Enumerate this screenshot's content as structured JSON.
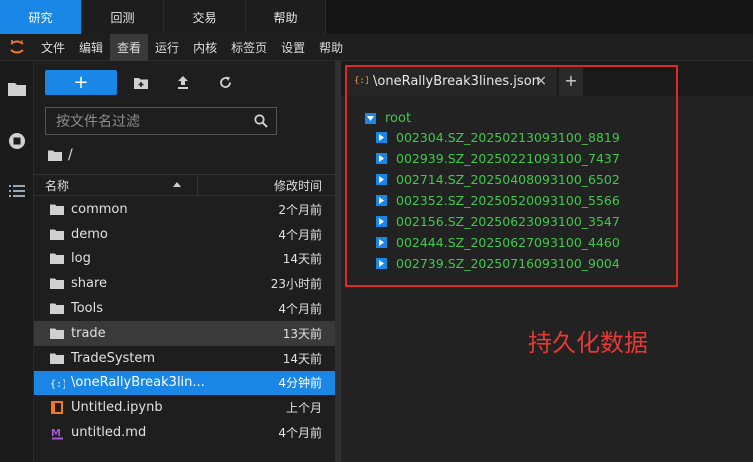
{
  "top_tabs": [
    "研究",
    "回测",
    "交易",
    "帮助"
  ],
  "menu": [
    "文件",
    "编辑",
    "查看",
    "运行",
    "内核",
    "标签页",
    "设置",
    "帮助"
  ],
  "file_browser": {
    "new_label": "+",
    "filter_placeholder": "按文件名过滤",
    "path": "/",
    "col_name": "名称",
    "col_modified": "修改时间",
    "files": [
      {
        "name": "common",
        "modified": "2个月前",
        "icon": "folder-icon"
      },
      {
        "name": "demo",
        "modified": "4个月前",
        "icon": "folder-icon"
      },
      {
        "name": "log",
        "modified": "14天前",
        "icon": "folder-icon"
      },
      {
        "name": "share",
        "modified": "23小时前",
        "icon": "folder-icon"
      },
      {
        "name": "Tools",
        "modified": "4个月前",
        "icon": "folder-icon"
      },
      {
        "name": "trade",
        "modified": "13天前",
        "icon": "folder-icon"
      },
      {
        "name": "TradeSystem",
        "modified": "14天前",
        "icon": "folder-icon"
      },
      {
        "name": "\\oneRallyBreak3lin...",
        "modified": "4分钟前",
        "icon": "json-file-icon"
      },
      {
        "name": "Untitled.ipynb",
        "modified": "上个月",
        "icon": "notebook-icon"
      },
      {
        "name": "untitled.md",
        "modified": "4个月前",
        "icon": "markdown-icon"
      }
    ]
  },
  "editor": {
    "tab_title": "\\oneRallyBreak3lines.json",
    "close_glyph": "×",
    "add_glyph": "+",
    "root_label": "root",
    "items": [
      "002304.SZ_20250213093100_8819",
      "002939.SZ_20250221093100_7437",
      "002714.SZ_20250408093100_6502",
      "002352.SZ_20250520093100_5566",
      "002156.SZ_20250623093100_3547",
      "002444.SZ_20250627093100_4460",
      "002739.SZ_20250716093100_9004"
    ],
    "annotation": "持久化数据"
  },
  "colors": {
    "accent": "#1a87e6",
    "tree_text": "#3fc94a",
    "annotation": "#e53935"
  }
}
